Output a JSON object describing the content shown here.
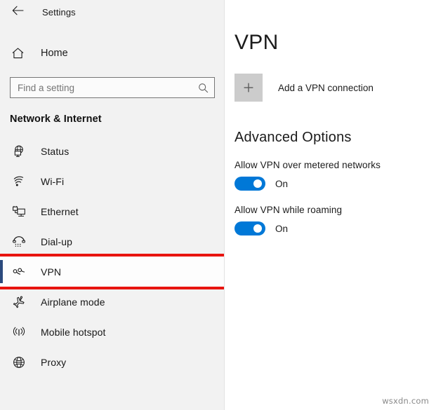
{
  "window": {
    "back_icon": "back-arrow-icon",
    "title": "Settings"
  },
  "sidebar": {
    "home": {
      "icon": "home-icon",
      "label": "Home"
    },
    "search": {
      "icon": "search-icon",
      "placeholder": "Find a setting",
      "value": ""
    },
    "section_title": "Network & Internet",
    "selection_bar_color": "#2b4a7d",
    "highlight_color": "#e8140f",
    "items": [
      {
        "icon": "status-globe-monitor-icon",
        "label": "Status",
        "selected": false,
        "highlighted": false
      },
      {
        "icon": "wifi-icon",
        "label": "Wi-Fi",
        "selected": false,
        "highlighted": false
      },
      {
        "icon": "ethernet-icon",
        "label": "Ethernet",
        "selected": false,
        "highlighted": false
      },
      {
        "icon": "dialup-phone-icon",
        "label": "Dial-up",
        "selected": false,
        "highlighted": false
      },
      {
        "icon": "vpn-icon",
        "label": "VPN",
        "selected": true,
        "highlighted": true
      },
      {
        "icon": "airplane-icon",
        "label": "Airplane mode",
        "selected": false,
        "highlighted": false
      },
      {
        "icon": "mobile-hotspot-icon",
        "label": "Mobile hotspot",
        "selected": false,
        "highlighted": false
      },
      {
        "icon": "proxy-globe-icon",
        "label": "Proxy",
        "selected": false,
        "highlighted": false
      }
    ]
  },
  "main": {
    "page_title": "VPN",
    "add_connection": {
      "icon": "plus-icon",
      "label": "Add a VPN connection"
    },
    "advanced_title": "Advanced Options",
    "accent_color": "#0078d7",
    "options": [
      {
        "label": "Allow VPN over metered networks",
        "state": "On",
        "checked": true
      },
      {
        "label": "Allow VPN while roaming",
        "state": "On",
        "checked": true
      }
    ]
  },
  "watermark": "wsxdn.com"
}
